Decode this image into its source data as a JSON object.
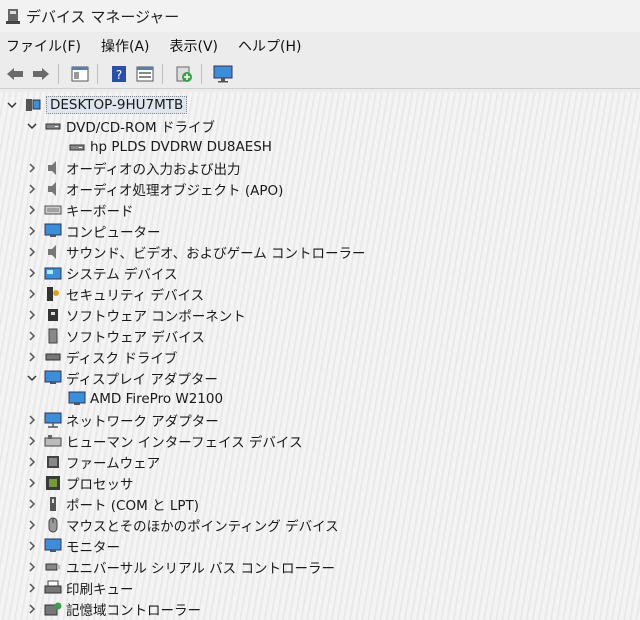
{
  "window": {
    "title": "デバイス マネージャー"
  },
  "menu": [
    "ファイル(F)",
    "操作(A)",
    "表示(V)",
    "ヘルプ(H)"
  ],
  "toolbar": [
    "back-icon",
    "forward-icon",
    "properties-icon",
    "help-icon",
    "view-icon",
    "scan-icon",
    "monitor-icon"
  ],
  "tree": {
    "root": "DESKTOP-9HU7MTB",
    "dvd": {
      "label": "DVD/CD-ROM ドライブ",
      "child": "hp PLDS DVDRW  DU8AESH"
    },
    "items": [
      "オーディオの入力および出力",
      "オーディオ処理オブジェクト (APO)",
      "キーボード",
      "コンピューター",
      "サウンド、ビデオ、およびゲーム コントローラー",
      "システム デバイス",
      "セキュリティ デバイス",
      "ソフトウェア コンポーネント",
      "ソフトウェア デバイス",
      "ディスク ドライブ"
    ],
    "display": {
      "label": "ディスプレイ アダプター",
      "child": "AMD FirePro W2100"
    },
    "items2": [
      "ネットワーク アダプター",
      "ヒューマン インターフェイス デバイス",
      "ファームウェア",
      "プロセッサ",
      "ポート (COM と LPT)",
      "マウスとそのほかのポインティング デバイス",
      "モニター",
      "ユニバーサル シリアル バス コントローラー",
      "印刷キュー",
      "記憶域コントローラー"
    ]
  }
}
